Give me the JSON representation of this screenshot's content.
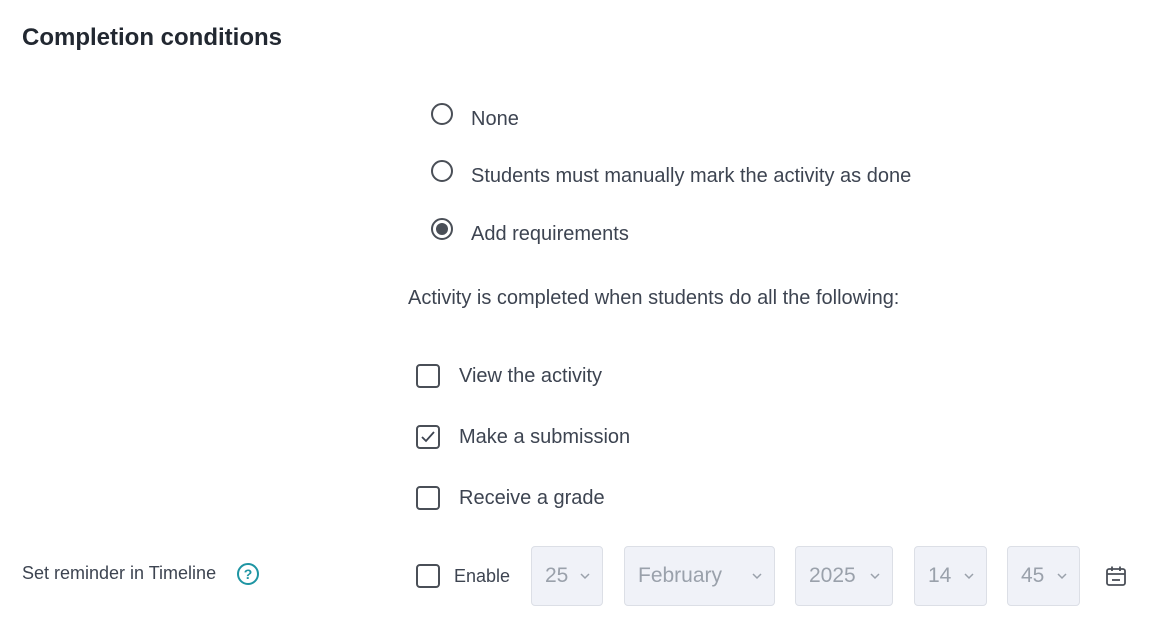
{
  "section": {
    "title": "Completion conditions"
  },
  "radios": [
    {
      "label": "None",
      "checked": false
    },
    {
      "label": "Students must manually mark the activity as done",
      "checked": false
    },
    {
      "label": "Add requirements",
      "checked": true
    }
  ],
  "requirements_intro": "Activity is completed when students do all the following:",
  "checkboxes": [
    {
      "label": "View the activity",
      "checked": false
    },
    {
      "label": "Make a submission",
      "checked": true
    },
    {
      "label": "Receive a grade",
      "checked": false
    }
  ],
  "reminder": {
    "label": "Set reminder in Timeline",
    "help_icon": "question-circle-icon",
    "help_glyph": "?",
    "enable_label": "Enable",
    "enabled": false,
    "day": "25",
    "month": "February",
    "year": "2025",
    "hour": "14",
    "minute": "45",
    "calendar_icon": "calendar-icon"
  },
  "colors": {
    "accent": "#1e95a3",
    "disabled_select_bg": "#f0f2f8",
    "text": "#3d4451"
  }
}
